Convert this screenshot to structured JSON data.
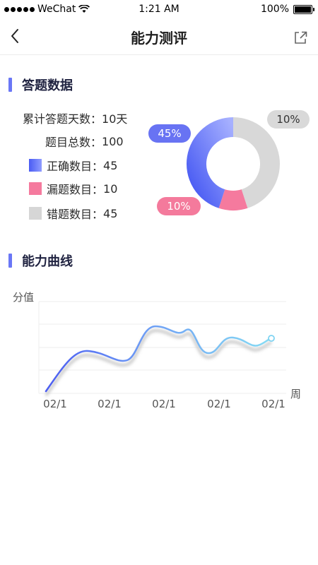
{
  "status_bar": {
    "carrier": "WeChat",
    "time": "1:21 AM",
    "battery": "100%"
  },
  "nav": {
    "title": "能力测评"
  },
  "answer_data": {
    "section_title": "答题数据",
    "stats": [
      {
        "label": "累计答题天数：",
        "value": "10天"
      },
      {
        "label": "题目总数：",
        "value": "100"
      },
      {
        "label": "正确数目：",
        "value": "45",
        "color": "#5a66f4"
      },
      {
        "label": "漏题数目：",
        "value": "10",
        "color": "#f57a9e"
      },
      {
        "label": "错题数目：",
        "value": "45",
        "color": "#d6d6d6"
      }
    ],
    "donut": {
      "segments": [
        {
          "name": "正确",
          "percent": 45,
          "label": "45%",
          "color": "#5a66f4"
        },
        {
          "name": "漏题",
          "percent": 10,
          "label": "10%",
          "color": "#f57a9e"
        },
        {
          "name": "错题",
          "percent": 45,
          "label": "10%",
          "color": "#d6d6d6"
        }
      ]
    }
  },
  "ability_curve": {
    "section_title": "能力曲线",
    "chart_data": {
      "type": "line",
      "ylabel": "分值",
      "xlabel": "周",
      "categories": [
        "02/1",
        "02/1",
        "02/1",
        "02/1",
        "02/1"
      ],
      "series": [
        {
          "values": [
            0.0,
            0.46,
            0.35,
            0.75,
            0.65,
            0.55,
            0.62
          ],
          "x": [
            0,
            0.9,
            1.6,
            2.1,
            2.7,
            3.3,
            4.0
          ]
        }
      ],
      "grid": true,
      "colors": [
        "#4b5cf2",
        "#79d0f5"
      ]
    }
  }
}
